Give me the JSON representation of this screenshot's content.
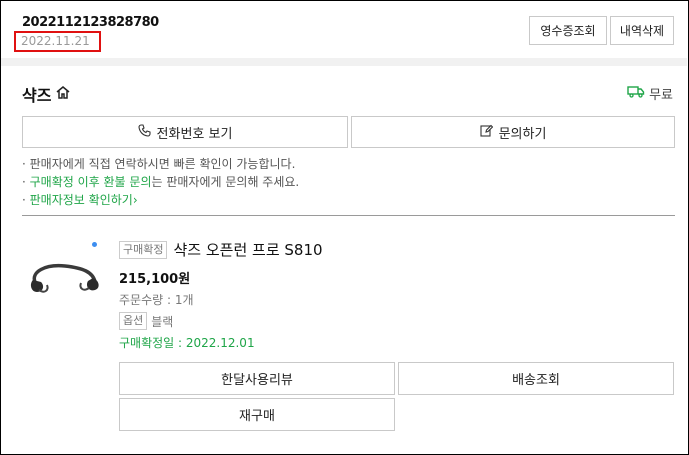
{
  "order": {
    "number": "2022112123828780",
    "date": "2022.11.21",
    "receipt_btn": "영수증조회",
    "delete_btn": "내역삭제"
  },
  "store": {
    "name": "샥즈",
    "shipping": "무료"
  },
  "actions": {
    "phone_btn": "전화번호 보기",
    "inquiry_btn": "문의하기"
  },
  "notes": {
    "line1": "판매자에게 직접 연락하시면 빠른 확인이 가능합니다.",
    "line2_green": "구매확정 이후 환불 문의",
    "line2_rest": "는 판매자에게 문의해 주세요.",
    "line3": "판매자정보 확인하기",
    "line3_arrow": "›"
  },
  "product": {
    "status_badge": "구매확정",
    "title": "샥즈 오픈런 프로 S810",
    "price": "215,100원",
    "quantity": "주문수량 : 1개",
    "option_label": "옵션",
    "option_value": "블랙",
    "confirm_date": "구매확정일 : 2022.12.01",
    "review_btn": "한달사용리뷰",
    "tracking_btn": "배송조회",
    "rebuy_btn": "재구매"
  },
  "colors": {
    "accent_green": "#1fa548",
    "highlight_red": "#e01111"
  }
}
